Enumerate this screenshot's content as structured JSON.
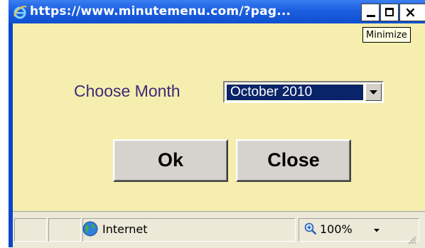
{
  "window": {
    "title": "https://www.minutemenu.com/?pag...",
    "tooltip": "Minimize"
  },
  "form": {
    "month_label": "Choose Month",
    "month_selected": "October 2010",
    "ok_label": "Ok",
    "close_label": "Close"
  },
  "status": {
    "zone": "Internet",
    "zoom": "100%"
  },
  "colors": {
    "title_bar": "#0f4fd0",
    "content_bg": "#f5eeae",
    "label_text": "#3b2a7a",
    "select_highlight": "#0a246a",
    "button_face": "#d6d3ce"
  },
  "icons": {
    "title": "internet-explorer-icon",
    "minimize": "minimize-icon",
    "maximize": "maximize-icon",
    "close": "close-icon",
    "dropdown": "chevron-down-icon",
    "zone": "globe-icon",
    "zoom": "magnifier-icon"
  }
}
